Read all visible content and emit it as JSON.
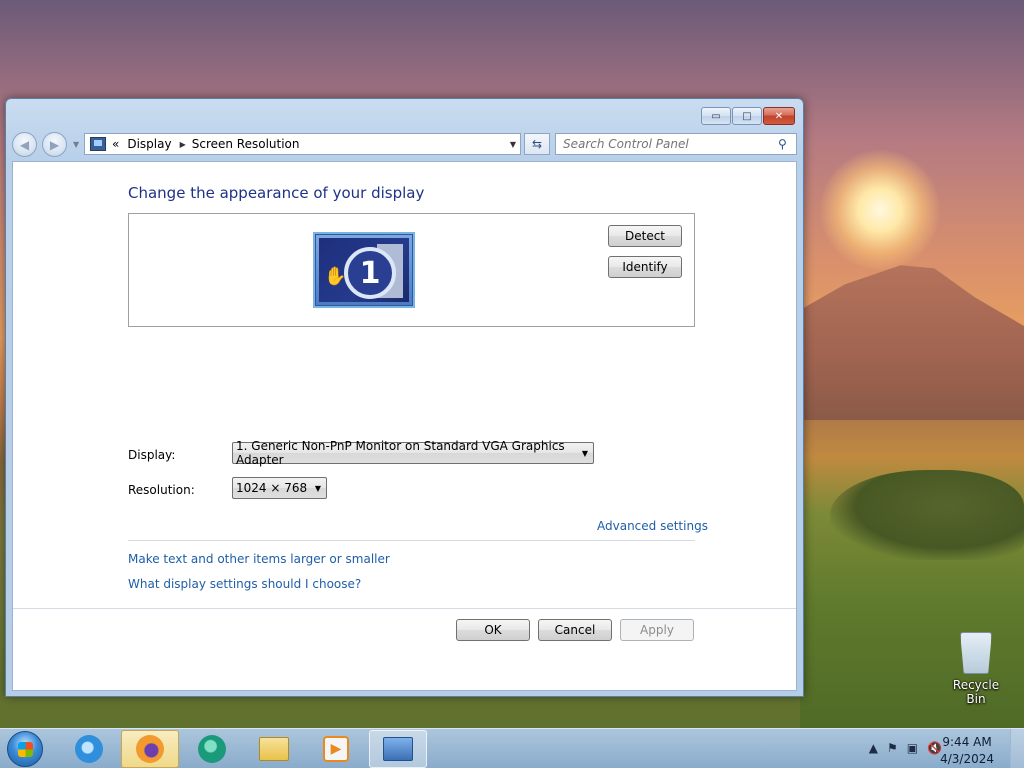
{
  "window": {
    "caption_buttons": {
      "minimize": "▭",
      "maximize": "□",
      "close": "✕"
    },
    "breadcrumb": {
      "overflow": "«",
      "items": [
        "Display",
        "Screen Resolution"
      ]
    },
    "search": {
      "placeholder": "Search Control Panel"
    }
  },
  "page": {
    "title": "Change the appearance of your display",
    "monitor_number": "1",
    "detect_label": "Detect",
    "identify_label": "Identify",
    "display_label": "Display:",
    "display_value": "1. Generic Non-PnP Monitor on Standard VGA Graphics Adapter",
    "resolution_label": "Resolution:",
    "resolution_value": "1024 × 768",
    "advanced_link": "Advanced settings",
    "text_size_link": "Make text and other items larger or smaller",
    "help_link": "What display settings should I choose?",
    "ok_label": "OK",
    "cancel_label": "Cancel",
    "apply_label": "Apply"
  },
  "desktop": {
    "icons": [
      {
        "label": "Recycle Bin",
        "icon": "recycle-bin-icon"
      }
    ]
  },
  "taskbar": {
    "items": [
      {
        "name": "internet-explorer",
        "icon": "internet-explorer-icon",
        "color": "#2f8fdd"
      },
      {
        "name": "firefox",
        "icon": "firefox-icon",
        "color": "#e8631c",
        "active": true
      },
      {
        "name": "chat-app",
        "icon": "chat-bubble-icon",
        "color": "#1a9a7a"
      },
      {
        "name": "file-explorer",
        "icon": "folder-icon",
        "color": "#e9c24a"
      },
      {
        "name": "media-player",
        "icon": "media-player-icon",
        "color": "#e98b1c"
      },
      {
        "name": "control-panel",
        "icon": "control-panel-icon",
        "color": "#3a6fb5",
        "open": true
      }
    ],
    "clock": {
      "time": "9:44 AM",
      "date": "4/3/2024"
    }
  }
}
